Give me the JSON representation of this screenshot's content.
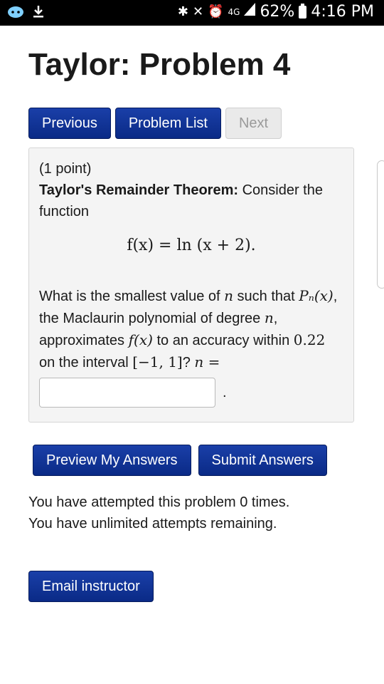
{
  "statusbar": {
    "battery": "62%",
    "time": "4:16 PM",
    "network": "4G"
  },
  "page": {
    "title": "Taylor: Problem 4"
  },
  "nav": {
    "previous": "Previous",
    "problem_list": "Problem List",
    "next": "Next"
  },
  "problem": {
    "points": "(1 point)",
    "theorem_name": "Taylor's Remainder Theorem:",
    "intro": " Consider the function",
    "formula": "f(x) = ln (x + 2).",
    "q1": "What is the smallest value of ",
    "n1": "n",
    "q2": " such that ",
    "pn": "Pₙ(x)",
    "q3": ", the Maclaurin polynomial of degree ",
    "n2": "n",
    "q4": ", approximates ",
    "fx": "f(x)",
    "q5": " to an accuracy within ",
    "tol": "0.22",
    "q6": " on the interval ",
    "interval": "[−1, 1]",
    "q7": "? ",
    "n_eq": "n =",
    "answer_value": "",
    "period": "."
  },
  "actions": {
    "preview": "Preview My Answers",
    "submit": "Submit Answers"
  },
  "info": {
    "attempted": "You have attempted this problem 0 times.",
    "remaining": "You have unlimited attempts remaining."
  },
  "email": {
    "label": "Email instructor"
  }
}
